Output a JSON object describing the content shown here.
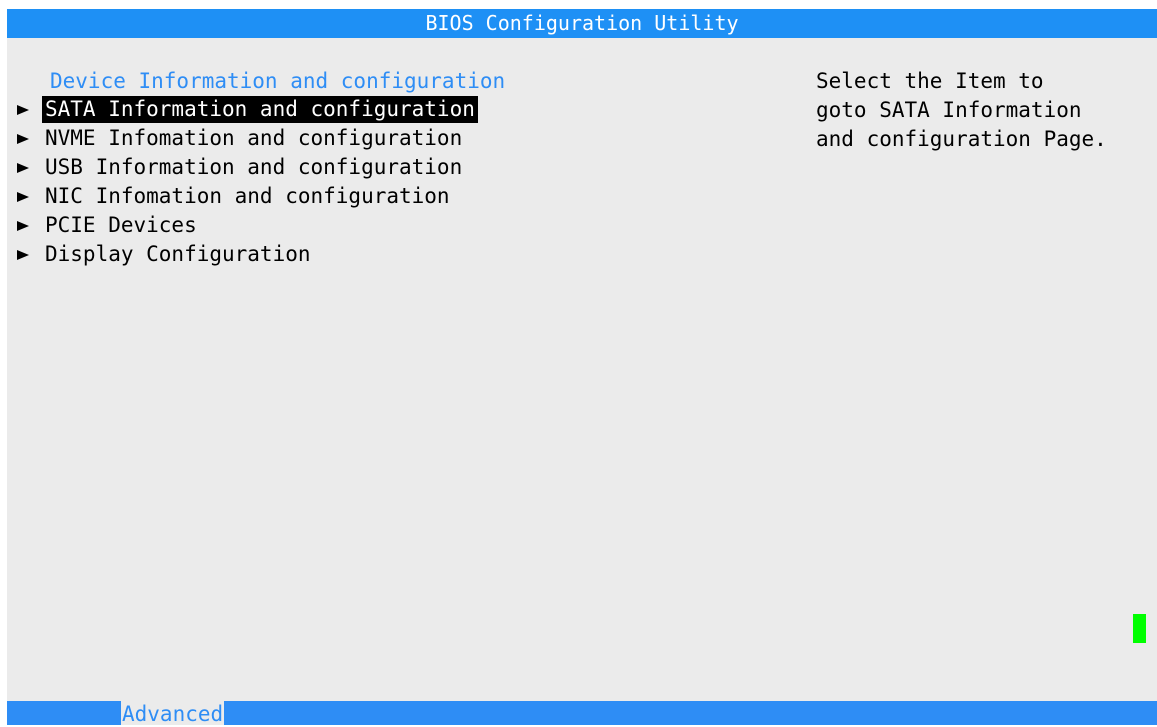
{
  "window": {
    "title": "BIOS Configuration Utility"
  },
  "section": {
    "heading": "Device Information and configuration"
  },
  "menu": {
    "items": [
      {
        "label": "SATA Information and configuration",
        "selected": true
      },
      {
        "label": "NVME Infomation and configuration",
        "selected": false
      },
      {
        "label": "USB Information and configuration",
        "selected": false
      },
      {
        "label": "NIC Infomation and configuration",
        "selected": false
      },
      {
        "label": "PCIE Devices",
        "selected": false
      },
      {
        "label": "Display Configuration",
        "selected": false
      }
    ],
    "arrow_icon": "right-pointer-icon"
  },
  "help": {
    "lines": [
      "Select the Item to",
      "goto SATA Information",
      "and configuration Page."
    ]
  },
  "footer": {
    "tabs": [
      {
        "label": "Advanced",
        "active": true
      }
    ]
  },
  "colors": {
    "title_bar": "#1e90f5",
    "accent_text": "#2e8df5",
    "panel_background": "#ebebeb",
    "selection_background": "#000000",
    "cursor": "#00ff00"
  }
}
